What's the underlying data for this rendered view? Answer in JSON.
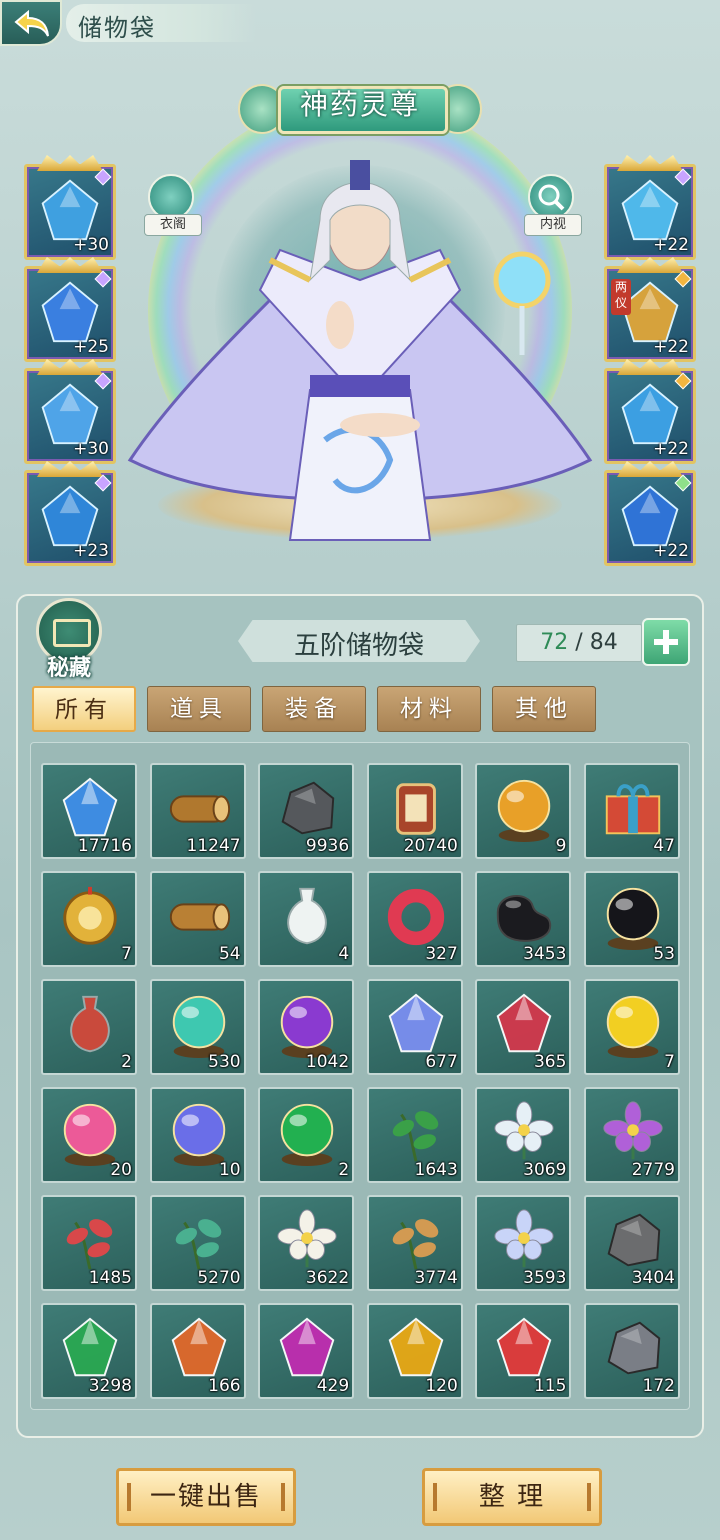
{
  "header": {
    "title": "储物袋"
  },
  "character": {
    "rank": "神药灵尊",
    "wardrobe_label": "衣阁",
    "inspect_label": "内视"
  },
  "equipment": {
    "left": [
      {
        "level": "+30",
        "color": "#3fa0e0",
        "gem": "purple"
      },
      {
        "level": "+25",
        "color": "#3a7fe0",
        "gem": "purple"
      },
      {
        "level": "+30",
        "color": "#4fa4e8",
        "gem": "purple"
      },
      {
        "level": "+23",
        "color": "#2f86d8",
        "gem": "purple"
      }
    ],
    "right": [
      {
        "level": "+22",
        "color": "#4fb8ea",
        "gem": "purple",
        "tag": ""
      },
      {
        "level": "+22",
        "color": "#d6a23c",
        "gem": "gold",
        "tag": "两仪"
      },
      {
        "level": "+22",
        "color": "#3c9fe2",
        "gem": "gold",
        "tag": ""
      },
      {
        "level": "+22",
        "color": "#2f73d6",
        "gem": "green",
        "tag": ""
      }
    ]
  },
  "bag": {
    "seal_label": "秘藏",
    "name": "五阶储物袋",
    "used": "72",
    "separator": " / ",
    "capacity": "84"
  },
  "tabs": [
    "所有",
    "道具",
    "装备",
    "材料",
    "其他"
  ],
  "active_tab": 0,
  "items": [
    {
      "name": "blue-crystal",
      "count": "17716",
      "color": "#3f8ee8",
      "shape": "gem"
    },
    {
      "name": "wood-log",
      "count": "11247",
      "color": "#b0782e",
      "shape": "log"
    },
    {
      "name": "dark-ore",
      "count": "9936",
      "color": "#55585c",
      "shape": "rock"
    },
    {
      "name": "seal-token",
      "count": "20740",
      "color": "#a8452a",
      "shape": "tag"
    },
    {
      "name": "dragon-orb",
      "count": "9",
      "color": "#e8a028",
      "shape": "orb"
    },
    {
      "name": "gift-box",
      "count": "47",
      "color": "#d44a36",
      "shape": "box"
    },
    {
      "name": "golden-mirror",
      "count": "7",
      "color": "#e2b23a",
      "shape": "disc"
    },
    {
      "name": "wood-bundle",
      "count": "54",
      "color": "#b98034",
      "shape": "log"
    },
    {
      "name": "white-vase",
      "count": "4",
      "color": "#eef3f2",
      "shape": "vase"
    },
    {
      "name": "red-ring",
      "count": "327",
      "color": "#e03a52",
      "shape": "ring"
    },
    {
      "name": "black-bean",
      "count": "3453",
      "color": "#1b1b1f",
      "shape": "bean"
    },
    {
      "name": "black-pearl",
      "count": "53",
      "color": "#15151a",
      "shape": "orb"
    },
    {
      "name": "red-gourd",
      "count": "2",
      "color": "#c94a3c",
      "shape": "vase"
    },
    {
      "name": "jade-orb",
      "count": "530",
      "color": "#3ec8b0",
      "shape": "orb"
    },
    {
      "name": "purple-orb",
      "count": "1042",
      "color": "#8a3ad0",
      "shape": "orb"
    },
    {
      "name": "violet-crystal",
      "count": "677",
      "color": "#7a8ef0",
      "shape": "gem"
    },
    {
      "name": "red-crystal",
      "count": "365",
      "color": "#d2384c",
      "shape": "gem"
    },
    {
      "name": "gold-orb",
      "count": "7",
      "color": "#f2cf22",
      "shape": "orb"
    },
    {
      "name": "pink-orb",
      "count": "20",
      "color": "#ec5a98",
      "shape": "orb"
    },
    {
      "name": "blue-orb",
      "count": "10",
      "color": "#6a6ee8",
      "shape": "orb"
    },
    {
      "name": "green-orb",
      "count": "2",
      "color": "#22b050",
      "shape": "orb"
    },
    {
      "name": "green-herb",
      "count": "1643",
      "color": "#3aa048",
      "shape": "leaf"
    },
    {
      "name": "lotus",
      "count": "3069",
      "color": "#e6f0f6",
      "shape": "flower"
    },
    {
      "name": "purple-orchid",
      "count": "2779",
      "color": "#b060d8",
      "shape": "flower"
    },
    {
      "name": "red-mushroom",
      "count": "1485",
      "color": "#d8484a",
      "shape": "leaf"
    },
    {
      "name": "spirit-sprout",
      "count": "5270",
      "color": "#4ab090",
      "shape": "leaf"
    },
    {
      "name": "white-flower",
      "count": "3622",
      "color": "#f4f2e8",
      "shape": "flower"
    },
    {
      "name": "ginseng-root",
      "count": "3774",
      "color": "#d29a52",
      "shape": "leaf"
    },
    {
      "name": "frost-flower",
      "count": "3593",
      "color": "#c8d4f8",
      "shape": "flower"
    },
    {
      "name": "grey-stone",
      "count": "3404",
      "color": "#6b6c6e",
      "shape": "rock"
    },
    {
      "name": "emerald",
      "count": "3298",
      "color": "#2aa852",
      "shape": "gem"
    },
    {
      "name": "amber-shard",
      "count": "166",
      "color": "#e0682a",
      "shape": "gem"
    },
    {
      "name": "magenta-gem",
      "count": "429",
      "color": "#c02cb0",
      "shape": "gem"
    },
    {
      "name": "topaz",
      "count": "120",
      "color": "#e8a814",
      "shape": "gem"
    },
    {
      "name": "ruby-shard",
      "count": "115",
      "color": "#e23a3a",
      "shape": "gem"
    },
    {
      "name": "silver-ore",
      "count": "172",
      "color": "#7a7e86",
      "shape": "rock"
    }
  ],
  "buttons": {
    "sell_all": "一键出售",
    "sort": "整 理"
  }
}
